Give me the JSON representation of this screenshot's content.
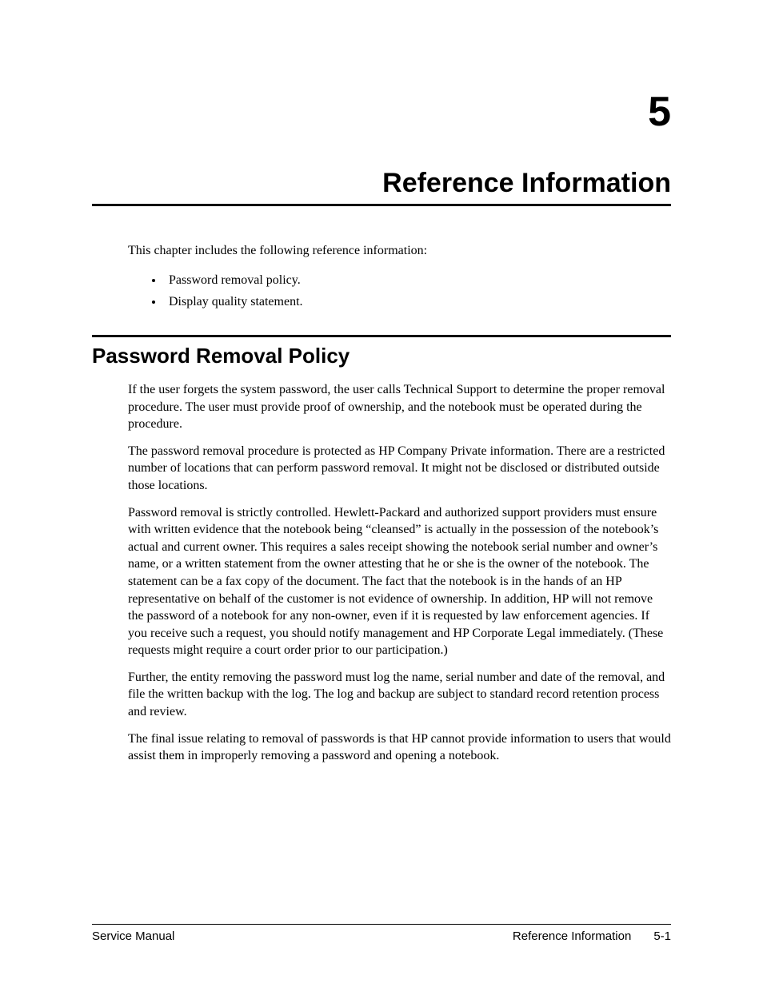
{
  "chapter": {
    "number": "5",
    "title": "Reference Information"
  },
  "intro": "This chapter includes the following reference information:",
  "bullets": [
    "Password removal policy.",
    "Display quality statement."
  ],
  "section": {
    "heading": "Password Removal Policy",
    "paragraphs": [
      "If the user forgets the system password, the user calls Technical Support to determine the proper removal procedure. The user must provide proof of ownership, and the notebook must be operated during the procedure.",
      "The password removal procedure is protected as HP Company Private information. There are a restricted number of locations that can perform password removal. It might not be disclosed or distributed outside those locations.",
      "Password removal is strictly controlled. Hewlett-Packard and authorized support providers must ensure with written evidence that the notebook being “cleansed” is actually in the possession of the notebook’s actual and current owner. This requires a sales receipt showing the notebook serial number and owner’s name, or a written statement from the owner attesting that he or she is the owner of the notebook. The statement can be a fax copy of the document. The fact that the notebook is in the hands of an HP representative on behalf of the customer is not evidence of ownership. In addition, HP will not remove the password of a notebook for any non-owner, even if it is requested by law enforcement agencies. If you receive such a request, you should notify management and HP Corporate Legal immediately. (These requests might require a court order prior to our participation.)",
      "Further, the entity removing the password must log the name, serial number and date of the removal, and file the written backup with the log. The log and backup are subject to standard record retention process and review.",
      "The final issue relating to removal of passwords is that HP cannot provide information to users that would assist them in improperly removing a password and opening a notebook."
    ]
  },
  "footer": {
    "left": "Service Manual",
    "center": "Reference Information",
    "page": "5-1"
  }
}
